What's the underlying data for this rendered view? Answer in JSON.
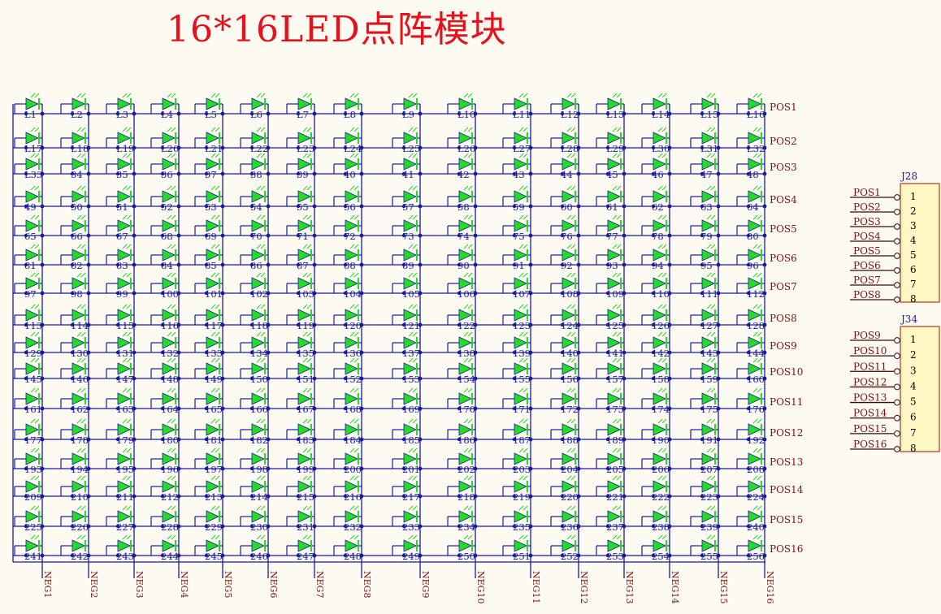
{
  "title": "16*16LED点阵模块",
  "row_labels": [
    "POS1",
    "POS2",
    "POS3",
    "POS4",
    "POS5",
    "POS6",
    "POS7",
    "POS8",
    "POS9",
    "POS10",
    "POS11",
    "POS12",
    "POS13",
    "POS14",
    "POS15",
    "POS16"
  ],
  "col_labels": [
    "NEG1",
    "NEG2",
    "NEG3",
    "NEG4",
    "NEG5",
    "NEG6",
    "NEG7",
    "NEG8",
    "NEG9",
    "NEG10",
    "NEG11",
    "NEG12",
    "NEG13",
    "NEG14",
    "NEG15",
    "NEG16"
  ],
  "led_labels": [
    "L1",
    "L2",
    "L3",
    "L4",
    "L5",
    "L6",
    "L7",
    "L8",
    "L9",
    "L10",
    "L11",
    "L12",
    "L13",
    "L14",
    "L15",
    "L16",
    "L17",
    "L18",
    "L19",
    "L20",
    "L21",
    "L22",
    "L23",
    "L24",
    "L25",
    "L26",
    "L27",
    "L28",
    "L29",
    "L30",
    "L31",
    "L32",
    "L33",
    "34",
    "35",
    "36",
    "37",
    "38",
    "39",
    "40",
    "41",
    "42",
    "43",
    "44",
    "45",
    "46",
    "47",
    "48",
    "49",
    "50",
    "51",
    "52",
    "53",
    "54",
    "55",
    "56",
    "57",
    "58",
    "59",
    "60",
    "61",
    "62",
    "63",
    "64",
    "65",
    "66",
    "67",
    "68",
    "69",
    "70",
    "71",
    "72",
    "73",
    "74",
    "75",
    "76",
    "77",
    "78",
    "79",
    "80",
    "81",
    "82",
    "83",
    "84",
    "85",
    "86",
    "87",
    "88",
    "89",
    "90",
    "91",
    "92",
    "93",
    "94",
    "95",
    "96",
    "97",
    "98",
    "99",
    "100",
    "101",
    "102",
    "103",
    "104",
    "105",
    "106",
    "107",
    "108",
    "109",
    "110",
    "111",
    "112",
    "113",
    "114",
    "115",
    "116",
    "117",
    "118",
    "119",
    "120",
    "121",
    "122",
    "123",
    "124",
    "125",
    "126",
    "127",
    "128",
    "129",
    "130",
    "131",
    "132",
    "133",
    "134",
    "135",
    "136",
    "137",
    "138",
    "139",
    "140",
    "141",
    "142",
    "143",
    "144",
    "145",
    "146",
    "147",
    "148",
    "149",
    "150",
    "151",
    "152",
    "153",
    "154",
    "155",
    "156",
    "157",
    "158",
    "159",
    "160",
    "161",
    "162",
    "163",
    "164",
    "165",
    "166",
    "167",
    "168",
    "169",
    "170",
    "171",
    "172",
    "173",
    "174",
    "175",
    "176",
    "177",
    "178",
    "179",
    "180",
    "181",
    "182",
    "183",
    "184",
    "185",
    "186",
    "187",
    "188",
    "189",
    "190",
    "191",
    "192",
    "193",
    "194",
    "195",
    "196",
    "197",
    "198",
    "199",
    "200",
    "201",
    "202",
    "203",
    "204",
    "205",
    "206",
    "207",
    "208",
    "209",
    "210",
    "211",
    "212",
    "213",
    "214",
    "215",
    "216",
    "217",
    "218",
    "219",
    "220",
    "221",
    "222",
    "223",
    "224",
    "225",
    "226",
    "227",
    "228",
    "229",
    "230",
    "231",
    "232",
    "233",
    "234",
    "235",
    "236",
    "237",
    "238",
    "239",
    "240",
    "241",
    "242",
    "243",
    "244",
    "245",
    "246",
    "247",
    "248",
    "249",
    "250",
    "251",
    "252",
    "253",
    "254",
    "255",
    "256"
  ],
  "connectors": [
    {
      "ref": "J28",
      "pins": [
        "1",
        "2",
        "3",
        "4",
        "5",
        "6",
        "7",
        "8"
      ],
      "nets": [
        "POS1",
        "POS2",
        "POS3",
        "POS4",
        "POS5",
        "POS6",
        "POS7",
        "POS8"
      ]
    },
    {
      "ref": "J34",
      "pins": [
        "1",
        "2",
        "3",
        "4",
        "5",
        "6",
        "7",
        "8"
      ],
      "nets": [
        "POS9",
        "POS10",
        "POS11",
        "POS12",
        "POS13",
        "POS14",
        "POS15",
        "POS16"
      ]
    }
  ],
  "colors": {
    "wire": "#1a1aa0",
    "label": "#7a1010",
    "led": "#22dd22",
    "title": "#e8101a",
    "connector_fill": "#fff7c4"
  }
}
